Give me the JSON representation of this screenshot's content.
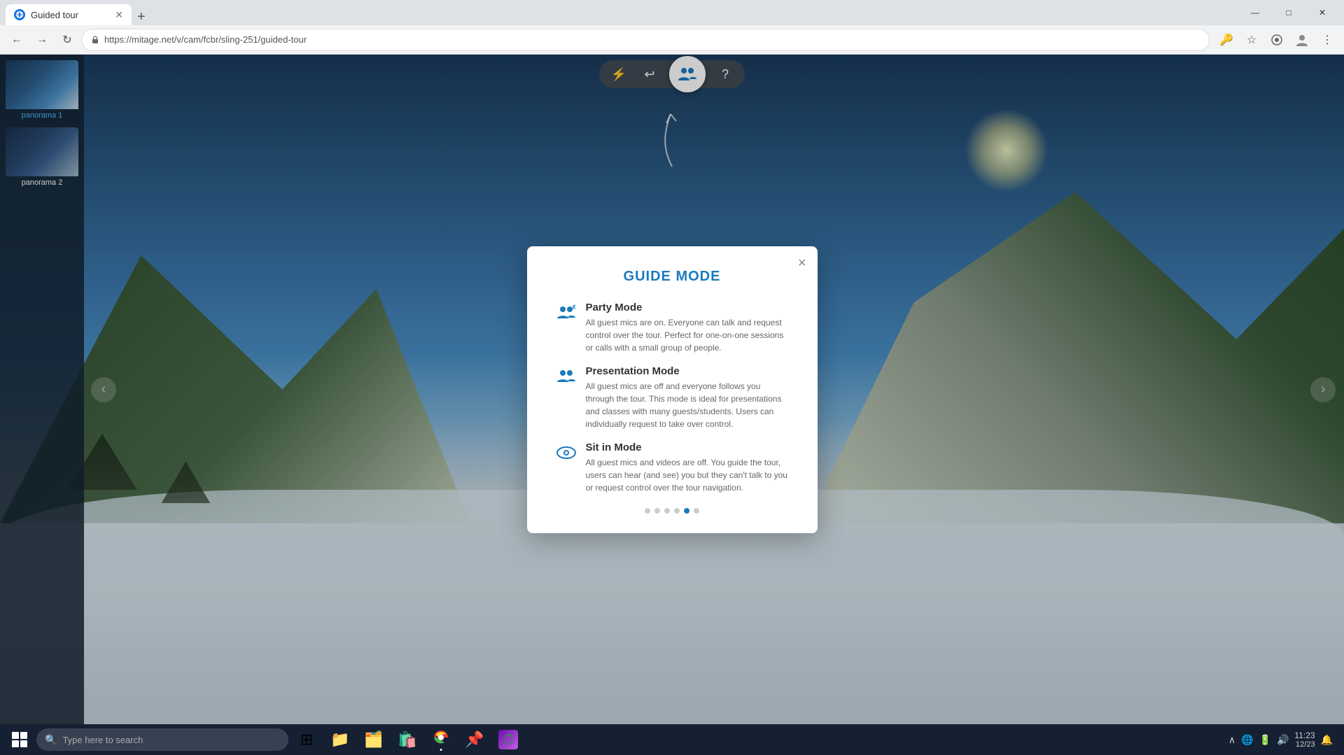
{
  "browser": {
    "tab": {
      "title": "Guided tour",
      "favicon": "🌐"
    },
    "new_tab_label": "+",
    "address": "https://mitage.net/v/cam/fcbr/sling-251/guided-tour",
    "window_controls": {
      "minimize": "—",
      "maximize": "□",
      "close": "✕"
    }
  },
  "tour": {
    "toolbar": {
      "lightning_label": "⚡",
      "undo_label": "↩",
      "guide_label": "guide-users-icon",
      "help_label": "?"
    }
  },
  "thumbnails": [
    {
      "label": "panorama 1",
      "active": true
    },
    {
      "label": "panorama 2",
      "active": false
    }
  ],
  "modal": {
    "title": "GUIDE MODE",
    "close_label": "×",
    "sections": [
      {
        "id": "party",
        "icon": "party-icon",
        "title": "Party Mode",
        "description": "All guest mics are on. Everyone can talk and request control over the tour. Perfect for one-on-one sessions or calls with a small group of people."
      },
      {
        "id": "presentation",
        "icon": "presentation-icon",
        "title": "Presentation Mode",
        "description": "All guest mics are off and everyone follows you through the tour. This mode is ideal for presentations and classes with many guests/students. Users can individually request to take over control."
      },
      {
        "id": "sitin",
        "icon": "eye-icon",
        "title": "Sit in Mode",
        "description": "All guest mics and videos are off. You guide the tour, users can hear (and see) you but they can't talk to you or request control over the tour navigation."
      }
    ],
    "dots": [
      {
        "active": false
      },
      {
        "active": false
      },
      {
        "active": false
      },
      {
        "active": false
      },
      {
        "active": true
      },
      {
        "active": false
      }
    ]
  },
  "nav_arrows": {
    "left": "‹",
    "right": "›"
  },
  "taskbar": {
    "search_placeholder": "Type here to search",
    "apps": [
      "📁",
      "🗂️",
      "🛍️",
      "🌐",
      "📌",
      "🎵"
    ],
    "time": "11:23",
    "date": "12/23"
  }
}
